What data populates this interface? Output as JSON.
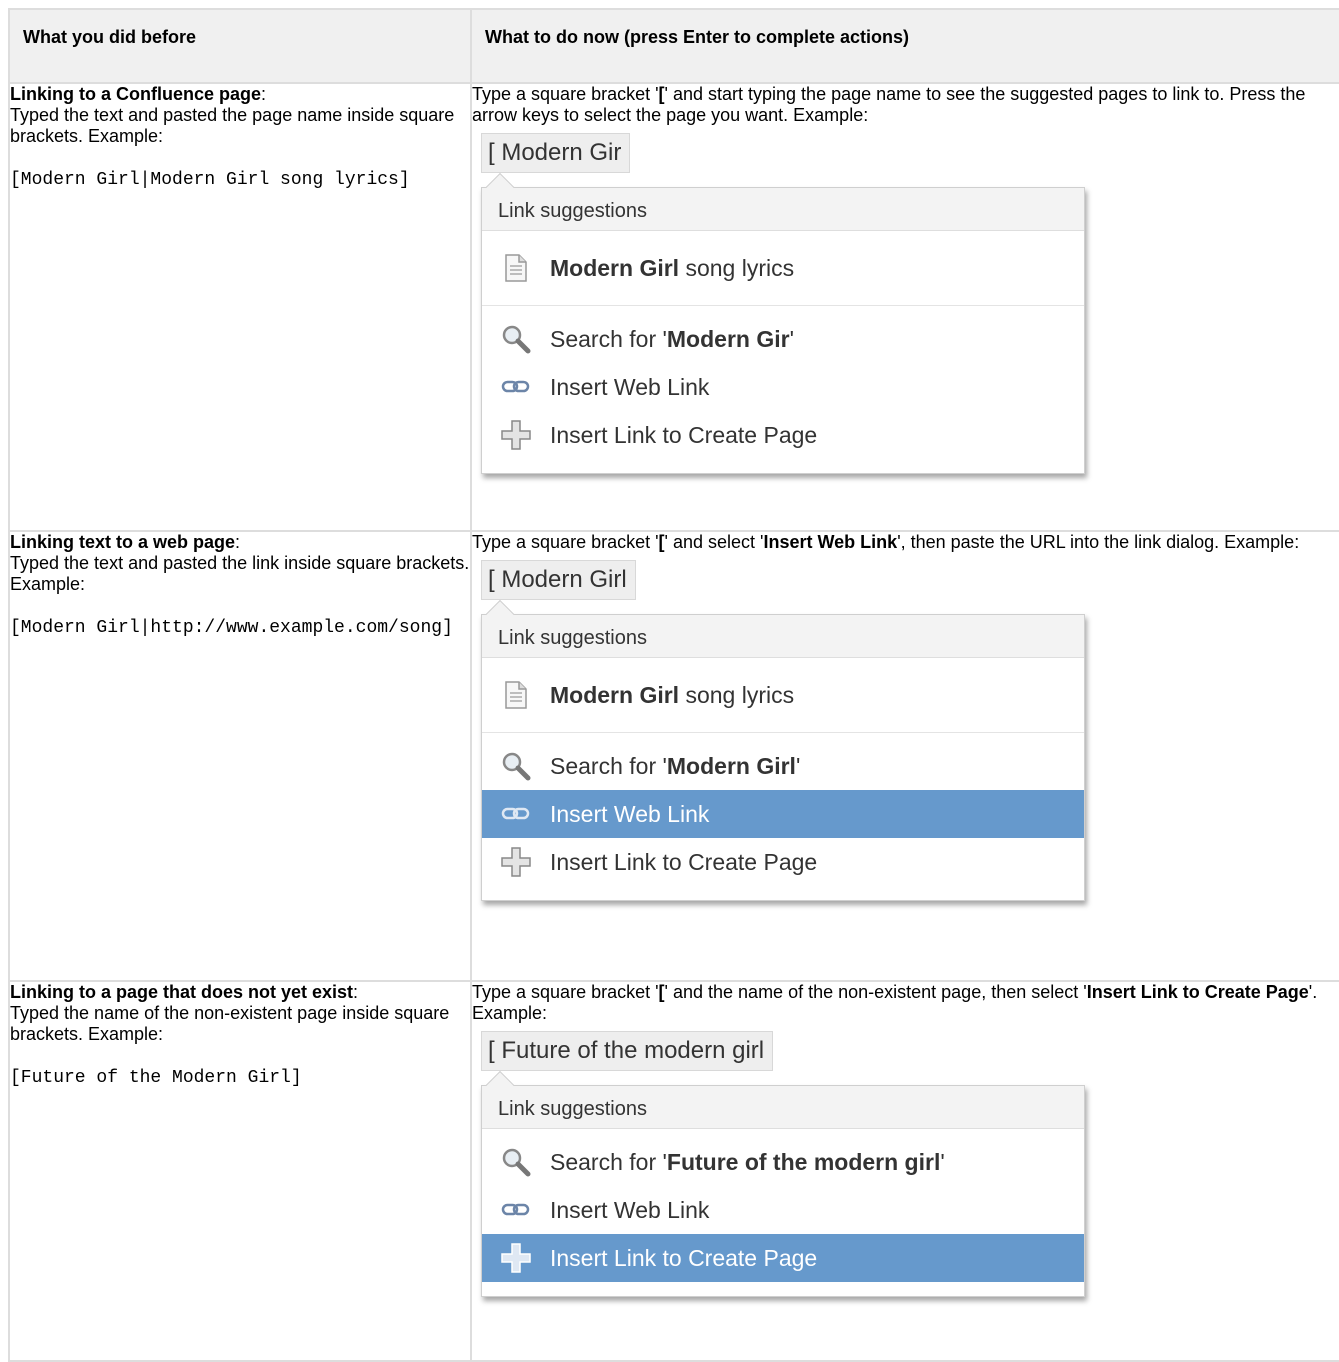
{
  "headers": {
    "before": "What you did before",
    "now": "What to do now (press Enter to complete actions)"
  },
  "rows": [
    {
      "before_title": "Linking to a Confluence page",
      "before_colon": ":",
      "before_desc": "Typed the text and pasted the page name inside square brackets. Example:",
      "before_code": "[Modern Girl|Modern Girl song lyrics]",
      "now_text": [
        "Type a square bracket '",
        "[",
        "' and start typing the page name to see the suggested pages to link to. Press the arrow keys to select the page you want. Example:"
      ],
      "typed": "[ Modern Gir",
      "popup": {
        "header": "Link suggestions",
        "page_bold": "Modern Girl",
        "page_rest": " song lyrics",
        "search_prefix": "Search for '",
        "search_bold": "Modern Gir",
        "search_suffix": "'",
        "web_link": "Insert Web Link",
        "create_link": "Insert Link to Create Page"
      }
    },
    {
      "before_title": "Linking text to a web page",
      "before_colon": ":",
      "before_desc": "Typed the text and pasted the link inside square brackets. Example:",
      "before_code": "[Modern Girl|http://www.example.com/song]",
      "now_text": [
        "Type a square bracket '",
        "[",
        "' and select '",
        "Insert Web Link",
        "', then paste the URL into the link dialog. Example:"
      ],
      "typed": "[ Modern Girl",
      "popup": {
        "header": "Link suggestions",
        "page_bold": "Modern Girl",
        "page_rest": " song lyrics",
        "search_prefix": "Search for '",
        "search_bold": "Modern Girl",
        "search_suffix": "'",
        "web_link": "Insert Web Link",
        "create_link": "Insert Link to Create Page"
      }
    },
    {
      "before_title": "Linking to a page that does not yet exist",
      "before_colon": ":",
      "before_desc": "Typed the name of the non-existent page inside square brackets. Example:",
      "before_code": "[Future of the Modern Girl]",
      "now_text": [
        "Type a square bracket '",
        "[",
        "' and the name of the non-existent page, then select '",
        "Insert Link to Create Page",
        "'. Example:"
      ],
      "typed": "[ Future of the modern girl",
      "popup": {
        "header": "Link suggestions",
        "search_prefix": "Search for '",
        "search_bold": "Future of the modern girl",
        "search_suffix": "'",
        "web_link": "Insert Web Link",
        "create_link": "Insert Link to Create Page"
      }
    }
  ],
  "colors": {
    "selected": "#6699cc",
    "header_bg": "#f0f0f0",
    "border": "#dddddd"
  },
  "icons": [
    "page-icon",
    "search-icon",
    "web-link-icon",
    "create-page-icon"
  ]
}
